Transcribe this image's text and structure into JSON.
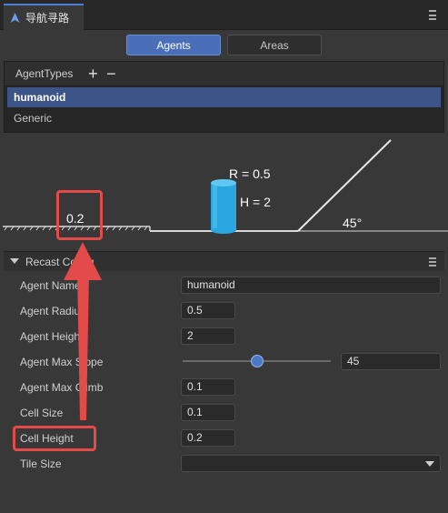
{
  "window": {
    "tab_title": "导航寻路",
    "tab_icon": "navigation-icon"
  },
  "mode_tabs": [
    {
      "label": "Agents",
      "active": true
    },
    {
      "label": "Areas",
      "active": false
    }
  ],
  "agent_types": {
    "title": "AgentTypes",
    "add_label": "+",
    "remove_label": "−",
    "items": [
      {
        "label": "humanoid",
        "selected": true
      },
      {
        "label": "Generic",
        "selected": false
      }
    ]
  },
  "diagram": {
    "step_value": "0.2",
    "radius_label": "R = 0.5",
    "height_label": "H = 2",
    "slope_label": "45°",
    "agent_color": "#2aa6e0"
  },
  "section": {
    "title": "Recast Config"
  },
  "properties": [
    {
      "label": "Agent Name",
      "value": "humanoid"
    },
    {
      "label": "Agent Radius",
      "value": "0.5"
    },
    {
      "label": "Agent Height",
      "value": "2"
    },
    {
      "label": "Agent Max Slope",
      "value": "45",
      "slider_fraction": 0.5
    },
    {
      "label": "Agent Max Climb",
      "value": "0.1"
    },
    {
      "label": "Cell Size",
      "value": "0.1"
    },
    {
      "label": "Cell Height",
      "value": "0.2"
    },
    {
      "label": "Tile Size",
      "value": ""
    }
  ],
  "colors": {
    "accent": "#4a6fb8",
    "annotation": "#e34a4a"
  }
}
